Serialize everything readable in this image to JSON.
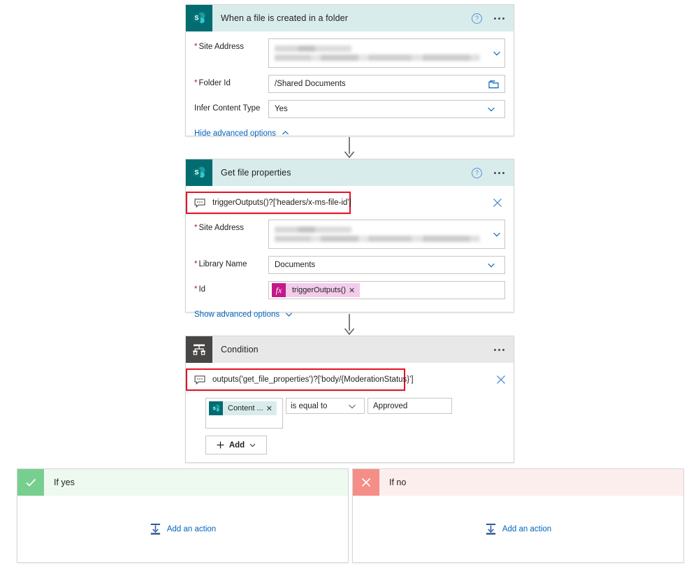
{
  "flow": {
    "cards": [
      {
        "id": "trigger",
        "title": "When a file is created in a folder",
        "connector": "sharepoint",
        "icon": "sharepoint-icon",
        "help_icon": "help-icon",
        "more_icon": "more-options-icon",
        "fields": [
          {
            "label": "Site Address",
            "required": true,
            "value": "",
            "redacted": true,
            "control": "dropdown",
            "chevron": "chevron-down-icon"
          },
          {
            "label": "Folder Id",
            "required": true,
            "value": "/Shared Documents",
            "redacted": false,
            "control": "picker",
            "trailing_icon": "folder-icon"
          },
          {
            "label": "Infer Content Type",
            "required": false,
            "value": "Yes",
            "redacted": false,
            "control": "dropdown",
            "chevron": "chevron-down-icon"
          }
        ],
        "advanced_toggle": {
          "label": "Hide advanced options",
          "icon": "chevron-up-icon"
        }
      },
      {
        "id": "get-file-properties",
        "title": "Get file properties",
        "connector": "sharepoint",
        "icon": "sharepoint-icon",
        "help_icon": "help-icon",
        "more_icon": "more-options-icon",
        "comment": {
          "text": "triggerOutputs()?['headers/x-ms-file-id']",
          "icon": "comment-icon",
          "close_icon": "close-icon",
          "highlight_color": "#e81123"
        },
        "fields": [
          {
            "label": "Site Address",
            "required": true,
            "value": "",
            "redacted": true,
            "control": "dropdown",
            "chevron": "chevron-down-icon"
          },
          {
            "label": "Library Name",
            "required": true,
            "value": "Documents",
            "redacted": false,
            "control": "dropdown",
            "chevron": "chevron-down-icon"
          },
          {
            "label": "Id",
            "required": true,
            "value": "",
            "redacted": false,
            "control": "token",
            "token": {
              "label": "triggerOutputs()",
              "prefix": "fx",
              "remove_icon": "remove-token-icon"
            }
          }
        ],
        "advanced_toggle": {
          "label": "Show advanced options",
          "icon": "chevron-down-icon"
        }
      },
      {
        "id": "condition",
        "title": "Condition",
        "connector": "control",
        "icon": "condition-icon",
        "more_icon": "more-options-icon",
        "comment": {
          "text": "outputs('get_file_properties')?['body/{ModerationStatus}']",
          "icon": "comment-icon",
          "close_icon": "close-icon",
          "highlight_color": "#e81123"
        },
        "condition_row": {
          "operand_token": {
            "label": "Content ...",
            "icon": "sharepoint-icon",
            "remove_icon": "remove-token-icon"
          },
          "operator": "is equal to",
          "operator_chevron": "chevron-down-icon",
          "value": "Approved"
        },
        "add_button": {
          "label": "Add",
          "plus_icon": "plus-icon",
          "chevron": "chevron-down-icon"
        }
      }
    ],
    "branches": [
      {
        "id": "if-yes",
        "label": "If yes",
        "badge_icon": "checkmark-icon",
        "badge_color": "#77cf8f",
        "header_color": "#eef9f0",
        "add_action": {
          "label": "Add an action",
          "icon": "insert-action-icon"
        }
      },
      {
        "id": "if-no",
        "label": "If no",
        "badge_icon": "cross-icon",
        "badge_color": "#f58e87",
        "header_color": "#fdeeee",
        "add_action": {
          "label": "Add an action",
          "icon": "insert-action-icon"
        }
      }
    ],
    "connectors": [
      {
        "from": "trigger",
        "to": "get-file-properties",
        "icon": "down-arrow-icon"
      },
      {
        "from": "get-file-properties",
        "to": "condition",
        "icon": "down-arrow-icon"
      }
    ]
  }
}
